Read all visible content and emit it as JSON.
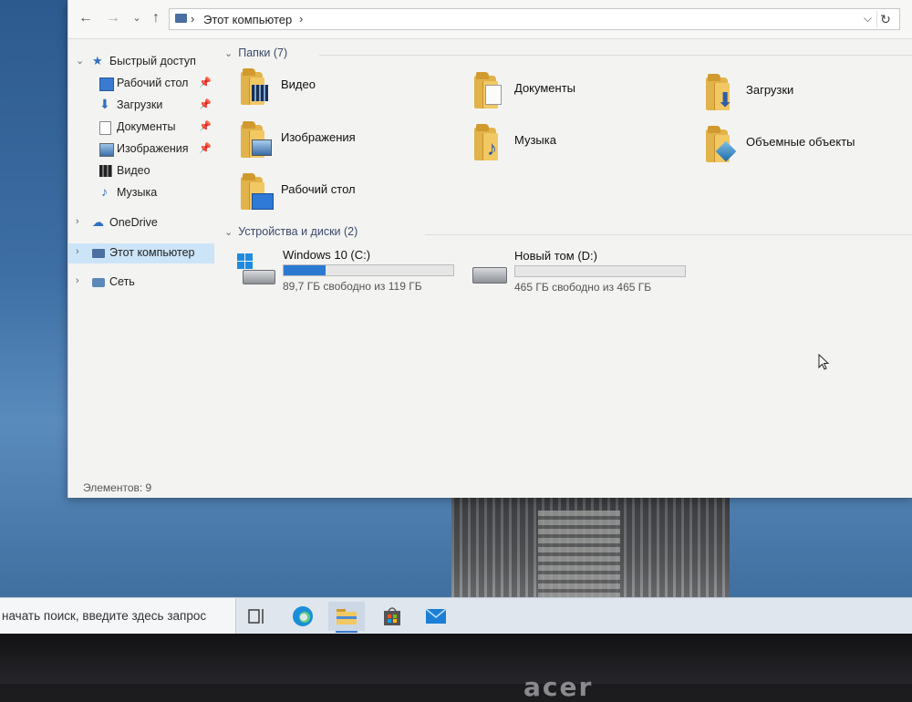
{
  "window": {
    "address": {
      "crumb": "Этот компьютер"
    },
    "sidebar": {
      "items": [
        {
          "label": "Быстрый доступ"
        },
        {
          "label": "Рабочий стол"
        },
        {
          "label": "Загрузки"
        },
        {
          "label": "Документы"
        },
        {
          "label": "Изображения"
        },
        {
          "label": "Видео"
        },
        {
          "label": "Музыка"
        },
        {
          "label": "OneDrive"
        },
        {
          "label": "Этот компьютер"
        },
        {
          "label": "Сеть"
        }
      ]
    },
    "folders_group": {
      "header": "Папки (7)",
      "items": [
        {
          "label": "Видео",
          "icon": "video-folder-icon"
        },
        {
          "label": "Документы",
          "icon": "documents-folder-icon"
        },
        {
          "label": "Загрузки",
          "icon": "downloads-folder-icon"
        },
        {
          "label": "Изображения",
          "icon": "pictures-folder-icon"
        },
        {
          "label": "Музыка",
          "icon": "music-folder-icon"
        },
        {
          "label": "Объемные объекты",
          "icon": "3d-objects-folder-icon"
        },
        {
          "label": "Рабочий стол",
          "icon": "desktop-folder-icon"
        }
      ]
    },
    "drives_group": {
      "header": "Устройства и диски (2)",
      "items": [
        {
          "label": "Windows 10 (C:)",
          "free_text": "89,7 ГБ свободно из 119 ГБ",
          "used_fraction": 0.246
        },
        {
          "label": "Новый том (D:)",
          "free_text": "465 ГБ свободно из 465 ГБ",
          "used_fraction": 0.0
        }
      ]
    },
    "status": "Элементов: 9"
  },
  "taskbar": {
    "search_placeholder": "начать поиск, введите здесь запрос",
    "apps": [
      "task-view",
      "edge",
      "file-explorer",
      "store",
      "mail"
    ]
  },
  "bezel": {
    "brand": "acer"
  },
  "colors": {
    "selection": "#cce4f7",
    "drive_bar": "#2a7ad2",
    "folder": "#e2b34a"
  }
}
